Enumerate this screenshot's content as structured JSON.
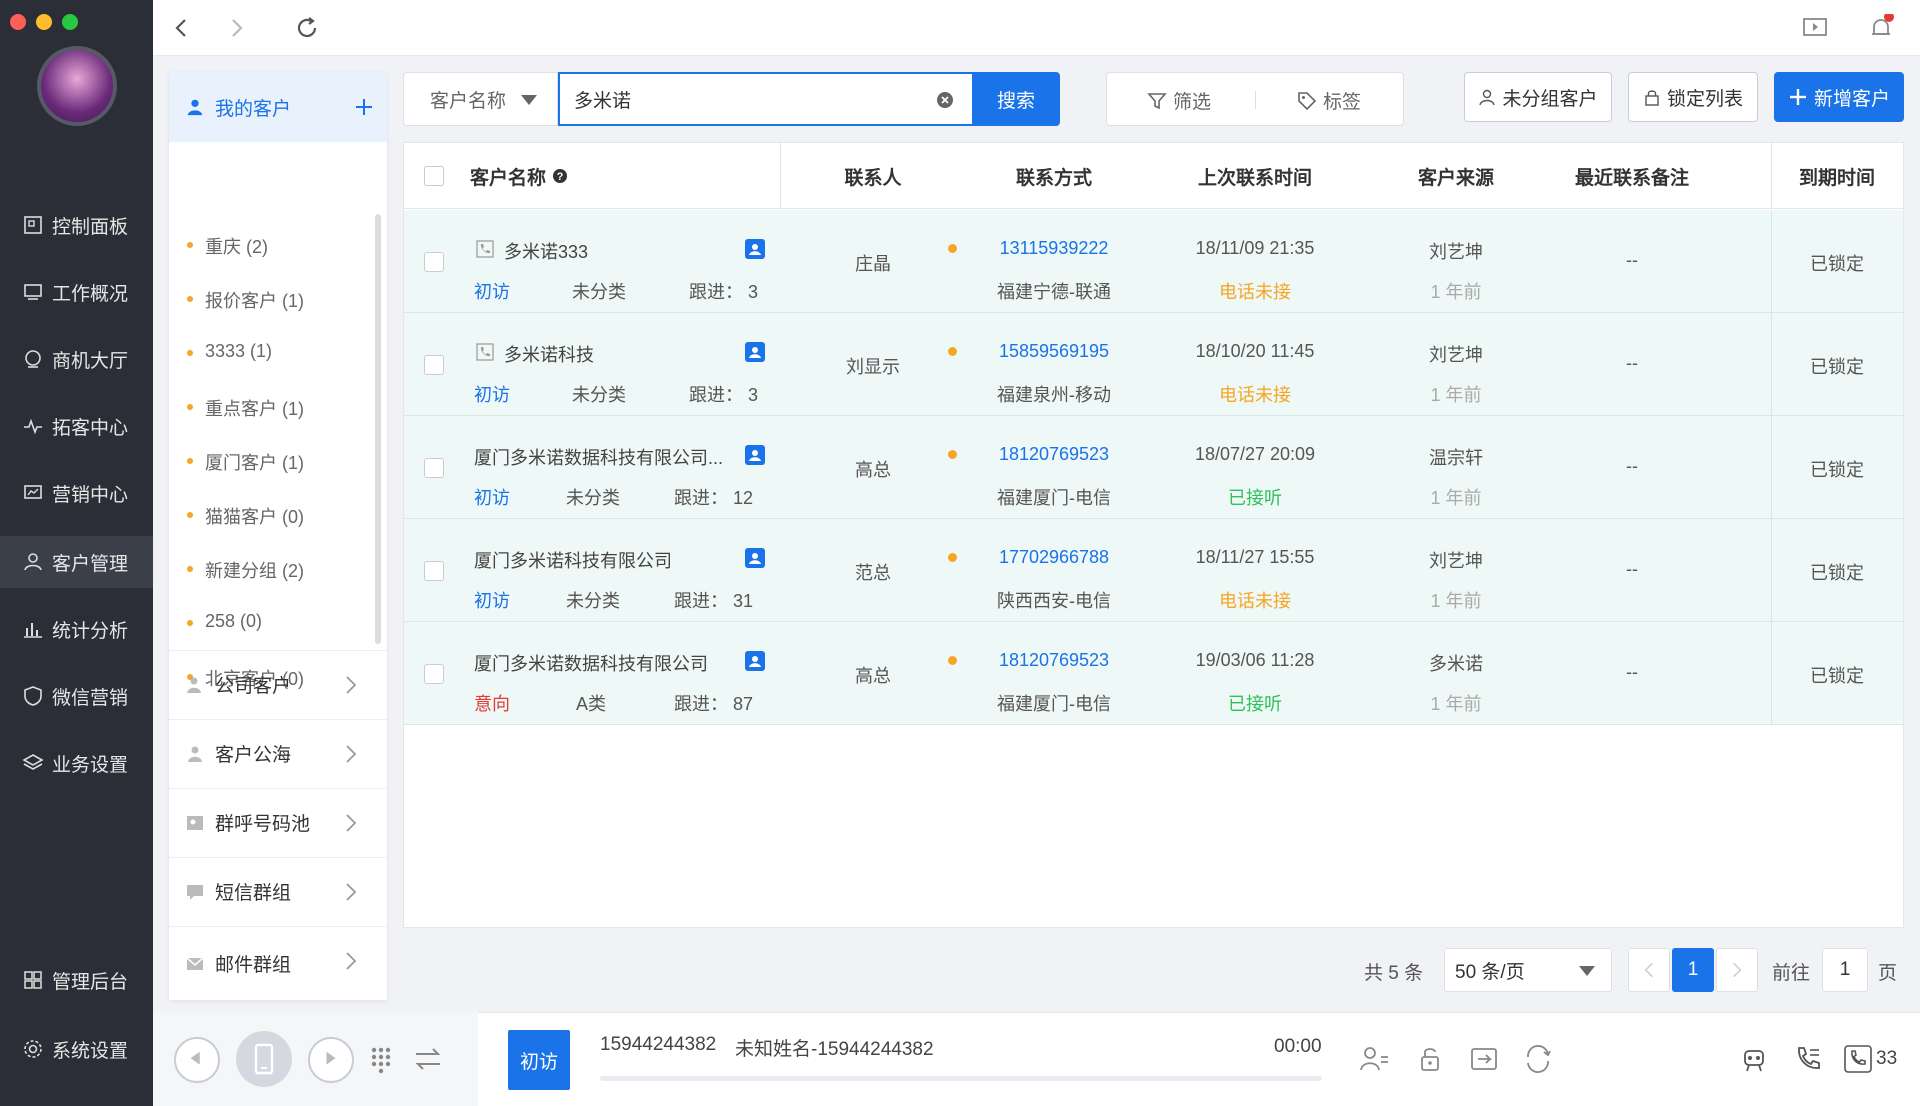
{
  "nav": {
    "items": [
      {
        "label": "控制面板",
        "icon": "dashboard-icon"
      },
      {
        "label": "工作概况",
        "icon": "monitor-icon"
      },
      {
        "label": "商机大厅",
        "icon": "opportunity-icon"
      },
      {
        "label": "拓客中心",
        "icon": "pulse-icon"
      },
      {
        "label": "营销中心",
        "icon": "chart-screen-icon"
      },
      {
        "label": "客户管理",
        "icon": "user-icon"
      },
      {
        "label": "统计分析",
        "icon": "bar-chart-icon"
      },
      {
        "label": "微信营销",
        "icon": "shield-icon"
      },
      {
        "label": "业务设置",
        "icon": "layers-icon"
      }
    ],
    "admin": "管理后台",
    "system": "系统设置"
  },
  "groups": {
    "my_customers": "我的客户",
    "items": [
      "重庆 (2)",
      "报价客户 (1)",
      "3333 (1)",
      "重点客户 (1)",
      "厦门客户 (1)",
      "猫猫客户 (0)",
      "新建分组 (2)",
      "258 (0)",
      "北京客户 (0)"
    ],
    "categories": [
      "公司客户",
      "客户公海",
      "群呼号码池",
      "短信群组",
      "邮件群组"
    ]
  },
  "search": {
    "field": "客户名称",
    "value": "多米诺",
    "button": "搜索",
    "filter": "筛选",
    "tag": "标签"
  },
  "actions": {
    "ungrouped": "未分组客户",
    "locked_list": "锁定列表",
    "add": "新增客户"
  },
  "table": {
    "headers": [
      "客户名称",
      "联系人",
      "联系方式",
      "上次联系时间",
      "客户来源",
      "最近联系备注",
      "到期时间"
    ],
    "rows": [
      {
        "name": "多米诺333",
        "stage": "初访",
        "category": "未分类",
        "follow": "跟进： 3",
        "contact": "庄晶",
        "phone": "13115939222",
        "region": "福建宁德-联通",
        "time": "18/11/09 21:35",
        "status": "电话未接",
        "source": "刘艺坤",
        "ago": "1 年前",
        "note": "--",
        "expire": "已锁定"
      },
      {
        "name": "多米诺科技",
        "stage": "初访",
        "category": "未分类",
        "follow": "跟进： 3",
        "contact": "刘显示",
        "phone": "15859569195",
        "region": "福建泉州-移动",
        "time": "18/10/20 11:45",
        "status": "电话未接",
        "source": "刘艺坤",
        "ago": "1 年前",
        "note": "--",
        "expire": "已锁定"
      },
      {
        "name": "厦门多米诺数据科技有限公司...",
        "stage": "初访",
        "category": "未分类",
        "follow": "跟进： 12",
        "contact": "高总",
        "phone": "18120769523",
        "region": "福建厦门-电信",
        "time": "18/07/27 20:09",
        "status": "已接听",
        "source": "温宗轩",
        "ago": "1 年前",
        "note": "--",
        "expire": "已锁定"
      },
      {
        "name": "厦门多米诺科技有限公司",
        "stage": "初访",
        "category": "未分类",
        "follow": "跟进： 31",
        "contact": "范总",
        "phone": "17702966788",
        "region": "陕西西安-电信",
        "time": "18/11/27 15:55",
        "status": "电话未接",
        "source": "刘艺坤",
        "ago": "1 年前",
        "note": "--",
        "expire": "已锁定"
      },
      {
        "name": "厦门多米诺数据科技有限公司",
        "stage": "意向",
        "category": "A类",
        "follow": "跟进： 87",
        "contact": "高总",
        "phone": "18120769523",
        "region": "福建厦门-电信",
        "time": "19/03/06 11:28",
        "status": "已接听",
        "source": "多米诺",
        "ago": "1 年前",
        "note": "--",
        "expire": "已锁定"
      }
    ]
  },
  "pagination": {
    "total": "共 5 条",
    "per_page": "50 条/页",
    "current": "1",
    "goto": "前往",
    "goto_value": "1",
    "page": "页"
  },
  "bottom": {
    "stage": "初访",
    "number": "15944244382",
    "name": "未知姓名-15944244382",
    "timer": "00:00",
    "count": "33"
  }
}
